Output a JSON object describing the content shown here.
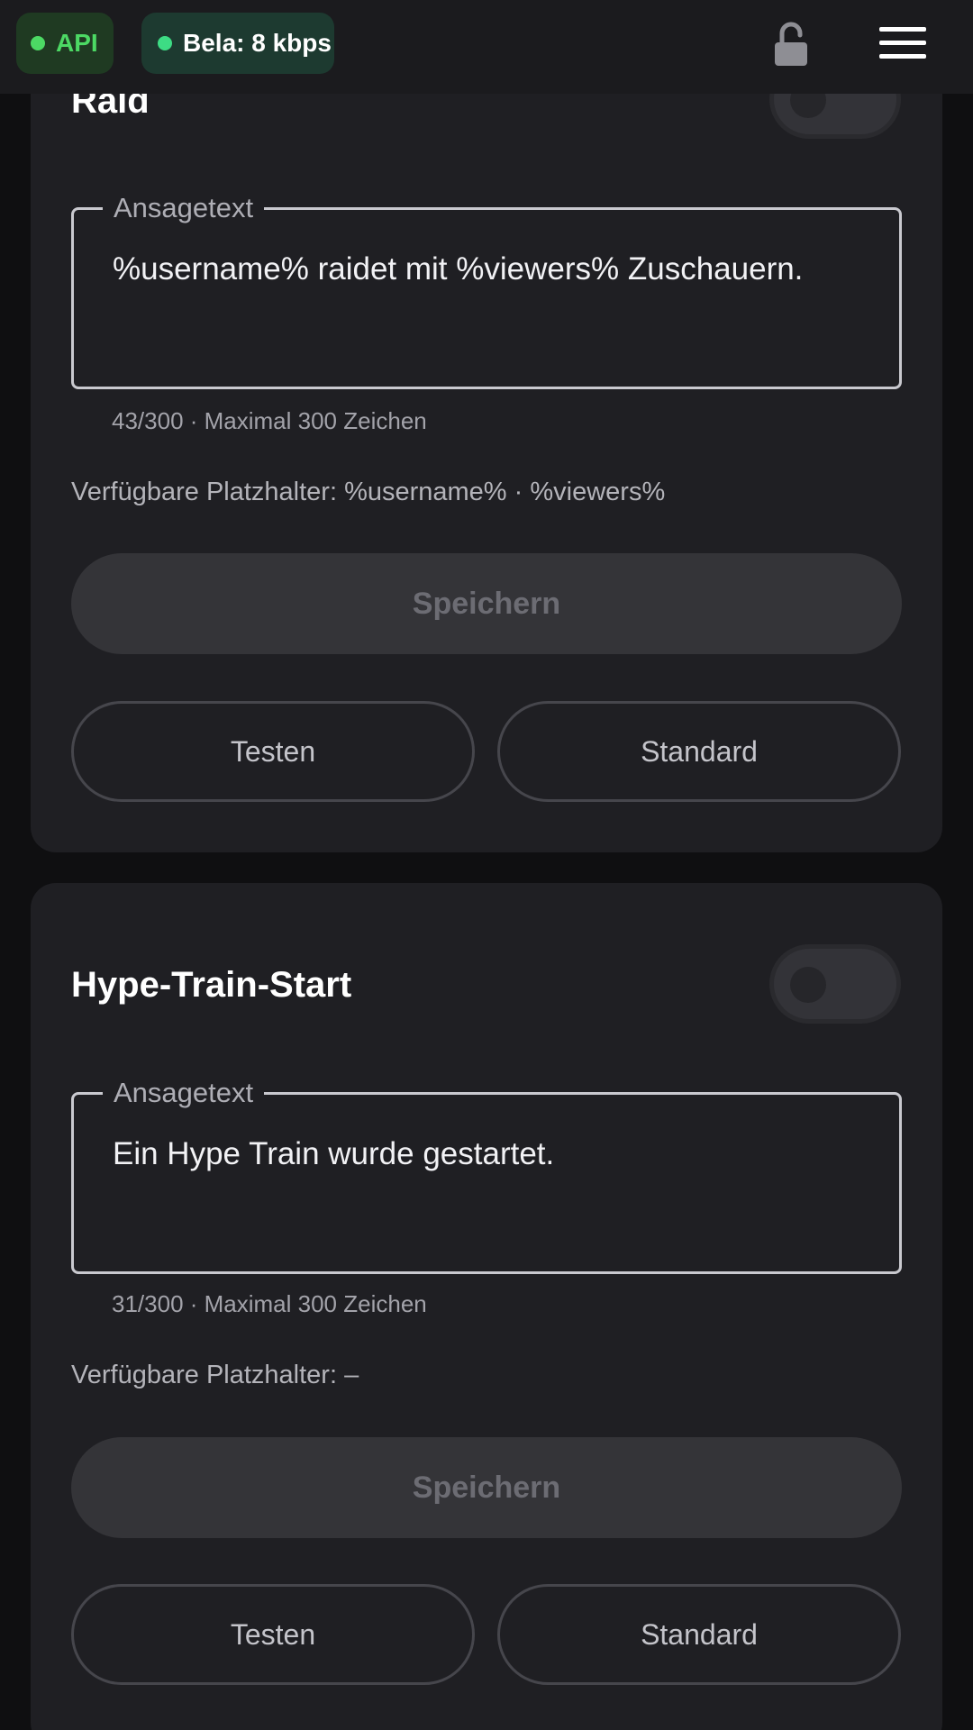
{
  "topbar": {
    "api_label": "API",
    "bitrate_label": "Bela: 8 kbps",
    "lock_icon": "unlocked-padlock-icon",
    "menu_icon": "hamburger-menu-icon"
  },
  "cards": [
    {
      "title": "Raid",
      "enabled": false,
      "legend": "Ansagetext",
      "text": "%username% raidet mit %viewers% Zuschauern.",
      "counter": "43/300 · Maximal 300 Zeichen",
      "placeholders": "Verfügbare Platzhalter: %username% · %viewers%",
      "save_label": "Speichern",
      "test_label": "Testen",
      "default_label": "Standard"
    },
    {
      "title": "Hype-Train-Start",
      "enabled": false,
      "legend": "Ansagetext",
      "text": "Ein Hype Train wurde gestartet.",
      "counter": "31/300 · Maximal 300 Zeichen",
      "placeholders": "Verfügbare Platzhalter: –",
      "save_label": "Speichern",
      "test_label": "Testen",
      "default_label": "Standard"
    }
  ],
  "colors": {
    "background": "#0f0f11",
    "card": "#1f1f23",
    "api_green": "#4cd964",
    "status_green": "#3ddc84"
  }
}
